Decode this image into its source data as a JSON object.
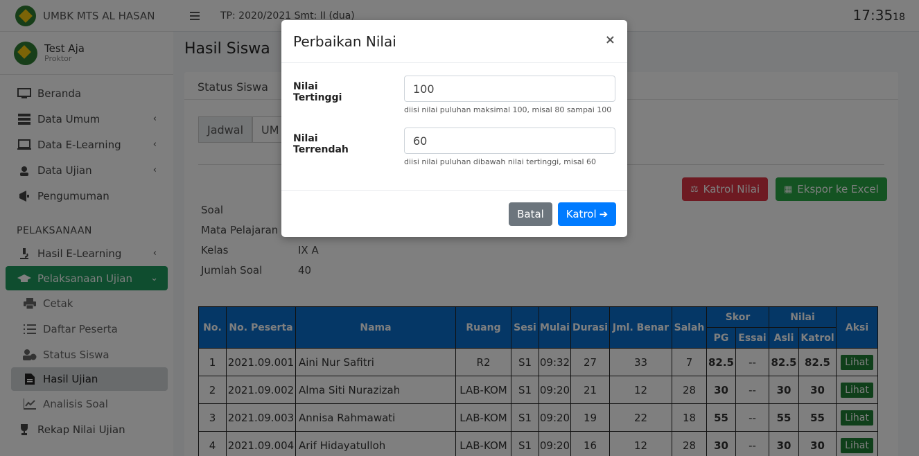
{
  "brand": {
    "name": "UMBK MTS AL HASAN"
  },
  "user": {
    "name": "Test Aja",
    "role": "Proktor"
  },
  "sidebar": {
    "items": [
      {
        "label": "Beranda",
        "icon": "monitor-icon"
      },
      {
        "label": "Data Umum",
        "icon": "server-icon"
      },
      {
        "label": "Data E-Learning",
        "icon": "laptop-icon"
      },
      {
        "label": "Data Ujian",
        "icon": "user-graduate-icon"
      },
      {
        "label": "Pengumuman",
        "icon": "megaphone-icon"
      }
    ],
    "section_label": "PELAKSANAAN",
    "items2": [
      {
        "label": "Hasil E-Learning",
        "icon": "microscope-icon"
      },
      {
        "label": "Pelaksanaan Ujian",
        "icon": "graduation-cap-icon"
      }
    ],
    "sub": [
      {
        "label": "Cetak",
        "icon": "print-icon"
      },
      {
        "label": "Daftar Peserta",
        "icon": "list-icon"
      },
      {
        "label": "Status Siswa",
        "icon": "user-clock-icon"
      },
      {
        "label": "Hasil Ujian",
        "icon": "file-icon"
      },
      {
        "label": "Analisis Soal",
        "icon": "chart-line-icon"
      }
    ],
    "last": {
      "label": "Rekap Nilai Ujian",
      "icon": "trophy-icon"
    }
  },
  "topbar": {
    "period": "TP: 2020/2021 Smt: II (dua)",
    "time_main": "17:35",
    "time_sec": "18"
  },
  "page": {
    "title": "Hasil Siswa",
    "card_title": "Status Siswa",
    "tabs": [
      "Jadwal",
      "UM"
    ]
  },
  "actions": {
    "katrol": "Katrol Nilai",
    "ekspor": "Ekspor ke Excel"
  },
  "info": [
    {
      "k": "Soal",
      "v": ""
    },
    {
      "k": "Mata Pelajaran",
      "v": ""
    },
    {
      "k": "Kelas",
      "v": "IX A"
    },
    {
      "k": "Jumlah Soal",
      "v": "40"
    }
  ],
  "table": {
    "headers": {
      "no": "No.",
      "no_peserta": "No. Peserta",
      "nama": "Nama",
      "ruang": "Ruang",
      "sesi": "Sesi",
      "mulai": "Mulai",
      "durasi": "Durasi",
      "jml_benar": "Jml. Benar",
      "salah": "Salah",
      "skor": "Skor",
      "nilai": "Nilai",
      "aksi": "Aksi",
      "pg": "PG",
      "essai": "Essai",
      "asli": "Asli",
      "katrol": "Katrol"
    },
    "rows": [
      {
        "no": "1",
        "id": "2021.09.001",
        "nama": "Aini Nur Safitri",
        "ruang": "R2",
        "sesi": "S1",
        "mulai": "09:32",
        "durasi": "27",
        "benar": "33",
        "salah": "7",
        "pg": "82.5",
        "essai": "--",
        "asli": "82.5",
        "katrol": "82.5",
        "aksi": "Lihat"
      },
      {
        "no": "2",
        "id": "2021.09.002",
        "nama": "Alma Siti Nurazizah",
        "ruang": "LAB-KOM",
        "sesi": "S1",
        "mulai": "09:20",
        "durasi": "21",
        "benar": "12",
        "salah": "28",
        "pg": "30",
        "essai": "--",
        "asli": "30",
        "katrol": "30",
        "aksi": "Lihat"
      },
      {
        "no": "3",
        "id": "2021.09.003",
        "nama": "Annisa Rahmawati",
        "ruang": "LAB-KOM",
        "sesi": "S1",
        "mulai": "09:20",
        "durasi": "19",
        "benar": "22",
        "salah": "18",
        "pg": "55",
        "essai": "--",
        "asli": "55",
        "katrol": "55",
        "aksi": "Lihat"
      },
      {
        "no": "4",
        "id": "2021.09.004",
        "nama": "Arif Hidayatulloh",
        "ruang": "LAB-KOM",
        "sesi": "S1",
        "mulai": "09:20",
        "durasi": "16",
        "benar": "12",
        "salah": "28",
        "pg": "30",
        "essai": "--",
        "asli": "30",
        "katrol": "30",
        "aksi": "Lihat"
      }
    ]
  },
  "modal": {
    "title": "Perbaikan Nilai",
    "close": "×",
    "max_label": "Nilai Tertinggi",
    "max_value": "100",
    "max_help": "diisi nilai puluhan maksimal 100, misal 80 sampai 100",
    "min_label": "Nilai Terrendah",
    "min_value": "60",
    "min_help": "diisi nilai puluhan dibawah nilai tertinggi, misal 60",
    "cancel": "Batal",
    "submit": "Katrol"
  }
}
